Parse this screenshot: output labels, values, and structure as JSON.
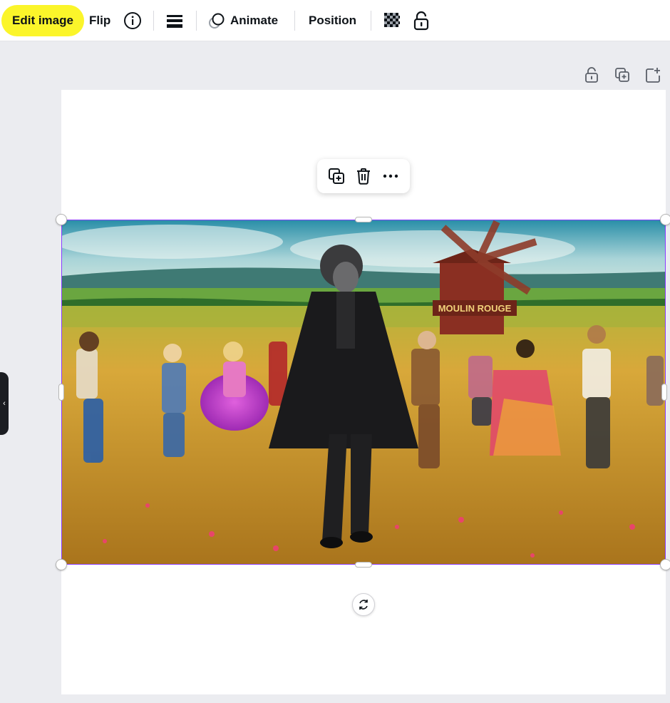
{
  "toolbar": {
    "edit_image_label": "Edit image",
    "flip_label": "Flip",
    "animate_label": "Animate",
    "position_label": "Position",
    "highlight_color": "#fbf52a",
    "icons": [
      "info-icon",
      "line-weight-icon",
      "animate-icon",
      "transparency-icon",
      "lock-icon"
    ]
  },
  "page_actions": {
    "icons": [
      "lock-icon",
      "duplicate-page-icon",
      "add-page-icon"
    ]
  },
  "float_menu": {
    "icons": [
      "duplicate-icon",
      "trash-icon",
      "more-icon"
    ]
  },
  "image": {
    "selection_color": "#8b3dff",
    "sign_text": "MOULIN ROUGE"
  },
  "side_panel": {
    "collapse_glyph": "‹"
  }
}
